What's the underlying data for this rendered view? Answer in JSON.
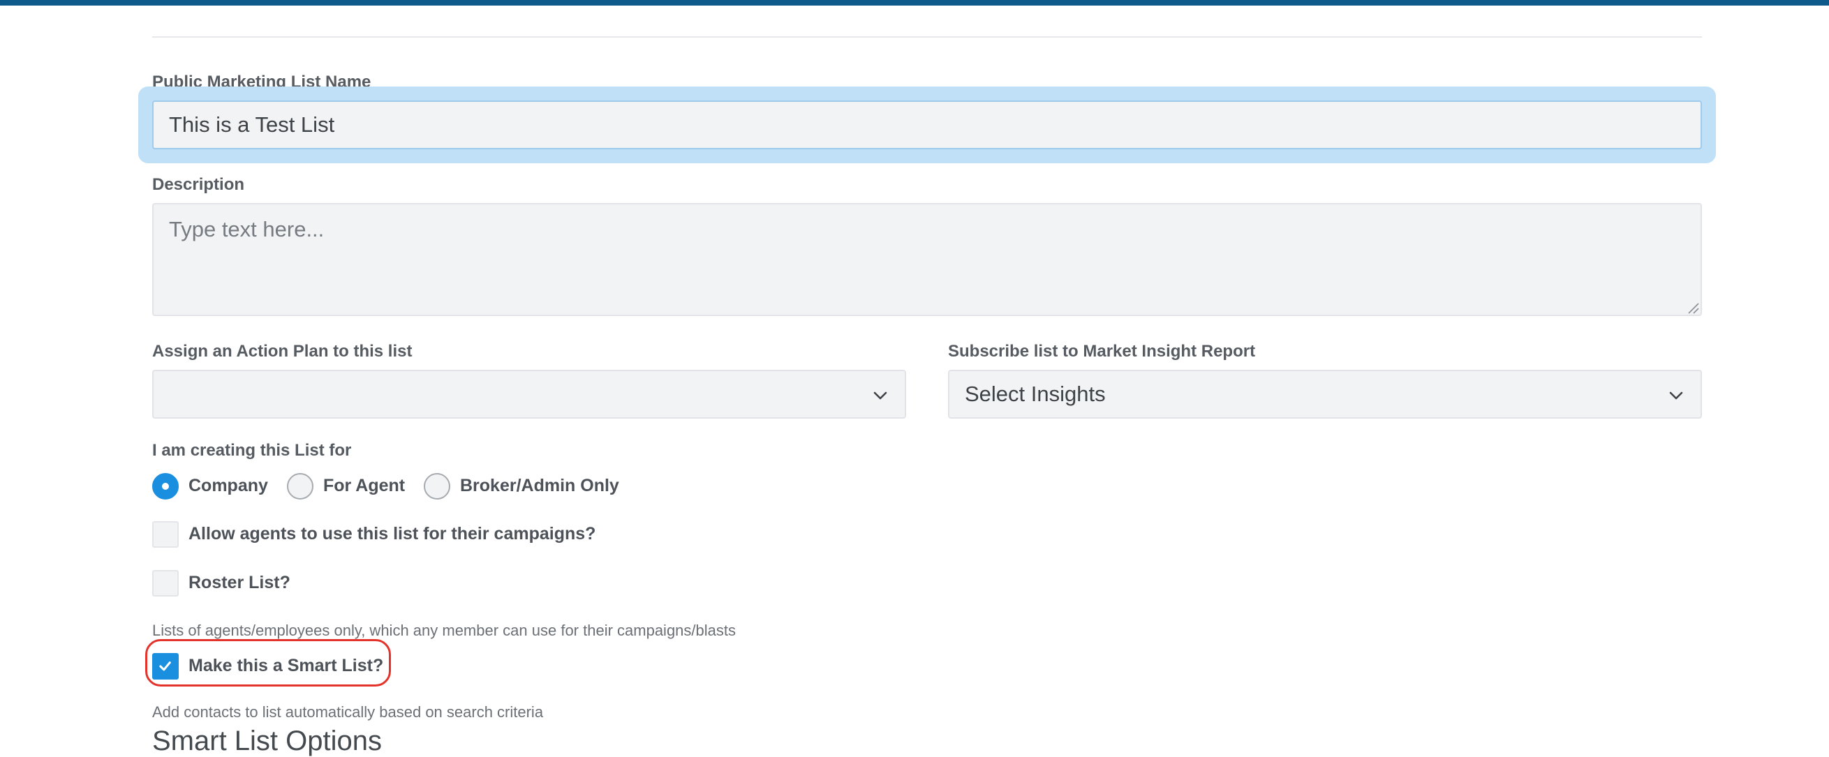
{
  "form": {
    "list_name": {
      "label": "Public Marketing List Name",
      "value": "This is a Test List"
    },
    "description": {
      "label": "Description",
      "placeholder": "Type text here..."
    },
    "action_plan": {
      "label": "Assign an Action Plan to this list",
      "selected": ""
    },
    "insight_report": {
      "label": "Subscribe list to Market Insight Report",
      "selected": "Select Insights"
    },
    "creating_for": {
      "label": "I am creating this List for",
      "options": [
        "Company",
        "For Agent",
        "Broker/Admin Only"
      ],
      "selected": "Company"
    },
    "allow_agents": {
      "label": "Allow agents to use this list for their campaigns?",
      "checked": false
    },
    "roster_list": {
      "label": "Roster List?",
      "checked": false,
      "help": "Lists of agents/employees only, which any member can use for their campaigns/blasts"
    },
    "smart_list": {
      "label": "Make this a Smart List?",
      "checked": true,
      "help": "Add contacts to list automatically based on search criteria"
    },
    "smart_list_options_title": "Smart List Options"
  },
  "colors": {
    "accent": "#1a8fe0",
    "top_bar": "#0e5a8a",
    "focus_ring": "#bfe0f7",
    "highlight": "#e4332a"
  },
  "icons": {
    "select_arrow": "chevron-down-icon",
    "checkbox_checked": "check-icon",
    "textarea_resize": "resize-grip-icon"
  }
}
